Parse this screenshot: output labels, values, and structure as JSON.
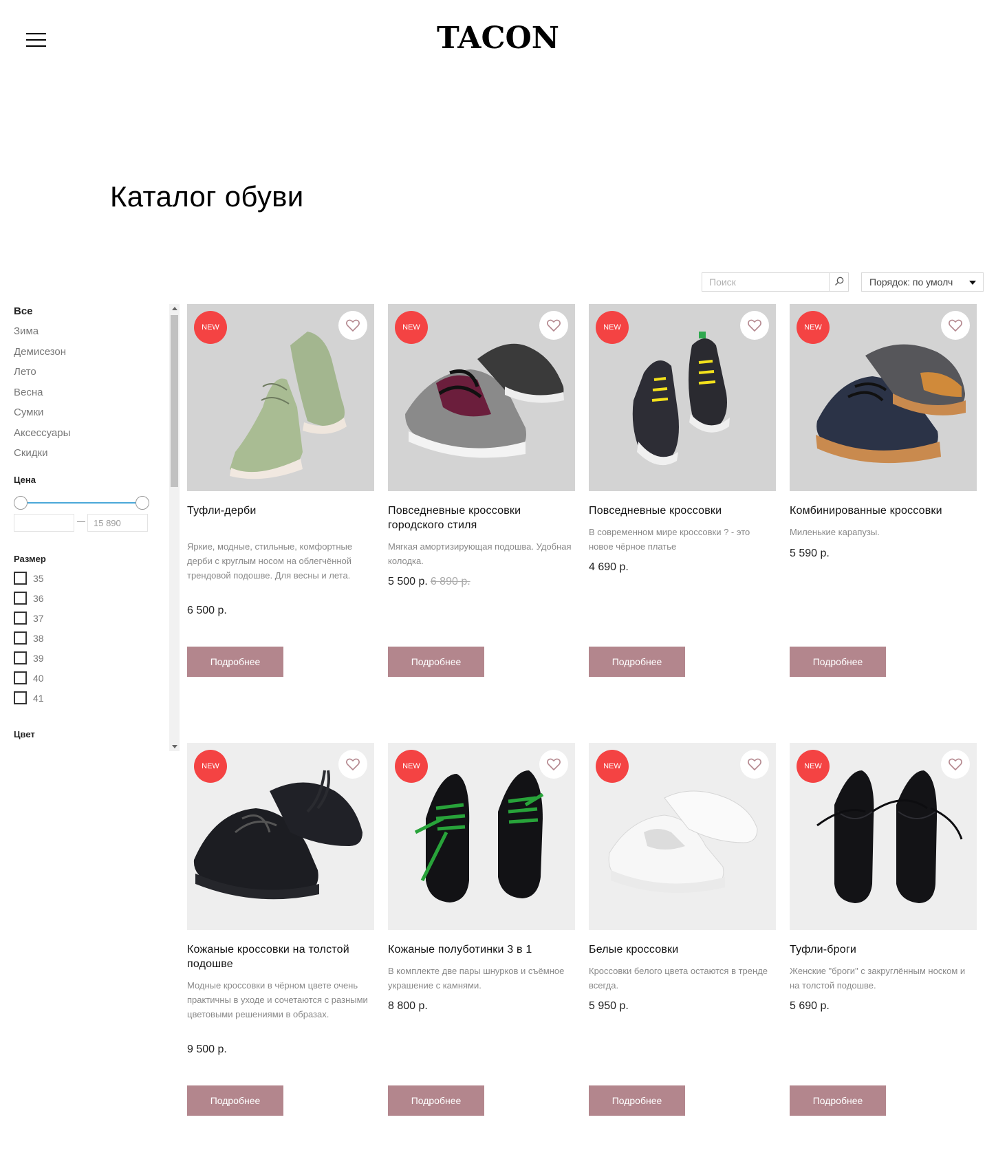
{
  "brand": {
    "logo": "TACON"
  },
  "page": {
    "title": "Каталог обуви"
  },
  "toolbar": {
    "search_placeholder": "Поиск",
    "sort_label": "Порядок: по умолч"
  },
  "sidebar": {
    "categories": [
      "Все",
      "Зима",
      "Демисезон",
      "Лето",
      "Весна",
      "Сумки",
      "Аксессуары",
      "Скидки"
    ],
    "price_label": "Цена",
    "price_min_value": "",
    "price_max_value": "15 890",
    "size_label": "Размер",
    "sizes": [
      "35",
      "36",
      "37",
      "38",
      "39",
      "40",
      "41"
    ],
    "color_label": "Цвет"
  },
  "colors": {
    "accent_button": "#b3868d",
    "badge": "#f44343",
    "slider": "#4aa8d8"
  },
  "products": [
    {
      "badge": "NEW",
      "title": "Туфли-дерби",
      "desc": "Яркие, модные, стильные, комфортные дерби с круглым носом на облегчённой трендовой подошве. Для весны и лета.",
      "price": "6 500 р.",
      "old_price": "",
      "button": "Подробнее",
      "image": "green-derby-shoes",
      "icon": "heart-icon"
    },
    {
      "badge": "NEW",
      "title": "Повседневные кроссовки городского стиля",
      "desc": "Мягкая амортизирующая подошва. Удобная колодка.",
      "price": "5 500 р.",
      "old_price": "6 890 р.",
      "button": "Подробнее",
      "image": "grey-burgundy-sneakers",
      "icon": "heart-icon"
    },
    {
      "badge": "NEW",
      "title": "Повседневные кроссовки",
      "desc": "В современном мире кроссовки ? - это новое чёрное платье",
      "price": "4 690 р.",
      "old_price": "",
      "button": "Подробнее",
      "image": "black-white-sneakers",
      "icon": "heart-icon"
    },
    {
      "badge": "NEW",
      "title": "Комбинированные кроссовки",
      "desc": "Миленькие карапузы.",
      "price": "5 590 р.",
      "old_price": "",
      "button": "Подробнее",
      "image": "orange-navy-sneakers",
      "icon": "heart-icon"
    },
    {
      "badge": "NEW",
      "title": "Кожаные кроссовки на толстой подошве",
      "desc": "Модные кроссовки в чёрном цвете очень практичны в уходе и сочетаются с разными цветовыми решениями в образах.",
      "price": "9 500 р.",
      "old_price": "",
      "button": "Подробнее",
      "image": "black-chunky-sneakers",
      "icon": "heart-icon"
    },
    {
      "badge": "NEW",
      "title": "Кожаные полуботинки 3 в 1",
      "desc": "В комплекте две пары шнурков и съёмное украшение с камнями.",
      "price": "8 800 р.",
      "old_price": "",
      "button": "Подробнее",
      "image": "black-shoes-green-laces",
      "icon": "heart-icon"
    },
    {
      "badge": "NEW",
      "title": "Белые кроссовки",
      "desc": "Кроссовки белого цвета остаются в тренде всегда.",
      "price": "5 950 р.",
      "old_price": "",
      "button": "Подробнее",
      "image": "white-sneakers",
      "icon": "heart-icon"
    },
    {
      "badge": "NEW",
      "title": "Туфли-броги",
      "desc": "Женские \"броги\" с закруглённым носком и на толстой подошве.",
      "price": "5 690 р.",
      "old_price": "",
      "button": "Подробнее",
      "image": "black-brogues",
      "icon": "heart-icon"
    }
  ]
}
